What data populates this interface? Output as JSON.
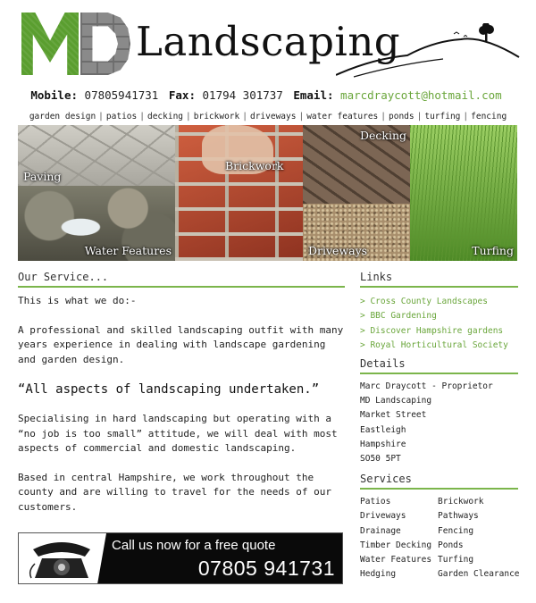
{
  "header": {
    "logo_letters": "MD",
    "logo_text": "Landscaping"
  },
  "contact": {
    "mobile_label": "Mobile:",
    "mobile": "07805941731",
    "fax_label": "Fax:",
    "fax": "01794 301737",
    "email_label": "Email:",
    "email": "marcdraycott@hotmail.com"
  },
  "nav": [
    "garden design",
    "patios",
    "decking",
    "brickwork",
    "driveways",
    "water features",
    "ponds",
    "turfing",
    "fencing"
  ],
  "photos": {
    "paving": "Paving",
    "water": "Water Features",
    "brickwork": "Brickwork",
    "decking": "Decking",
    "driveways": "Driveways",
    "turfing": "Turfing"
  },
  "main": {
    "heading": "Our Service...",
    "intro": "This is what we do:-",
    "p1": "A professional and skilled landscaping outfit with many years experience in dealing with landscape gardening and garden design.",
    "quote": "“All aspects of landscaping undertaken.”",
    "p2": "Specialising in hard landscaping but operating with a “no job is too small” attitude, we will deal with most aspects of commercial and domestic landscaping.",
    "p3": "Based in central Hampshire, we work throughout the county and are willing to travel for the needs of our customers."
  },
  "banner": {
    "cta": "Call us now for a free quote",
    "number": "07805 941731"
  },
  "links": {
    "heading": "Links",
    "items": [
      "> Cross County Landscapes",
      "> BBC Gardening",
      "> Discover Hampshire gardens",
      "> Royal Horticultural Society"
    ]
  },
  "details": {
    "heading": "Details",
    "lines": [
      "Marc Draycott - Proprietor",
      "MD Landscaping",
      "Market Street",
      "Eastleigh",
      "Hampshire",
      "SO50 5PT"
    ]
  },
  "services": {
    "heading": "Services",
    "col1": [
      "Patios",
      "Driveways",
      "Drainage",
      "Timber Decking",
      "Water Features",
      "Hedging"
    ],
    "col2": [
      "Brickwork",
      "Pathways",
      "Fencing",
      "Ponds",
      "Turfing",
      "Garden Clearance"
    ]
  },
  "colors": {
    "accent": "#6aa63b",
    "rule": "#7bb54b"
  }
}
